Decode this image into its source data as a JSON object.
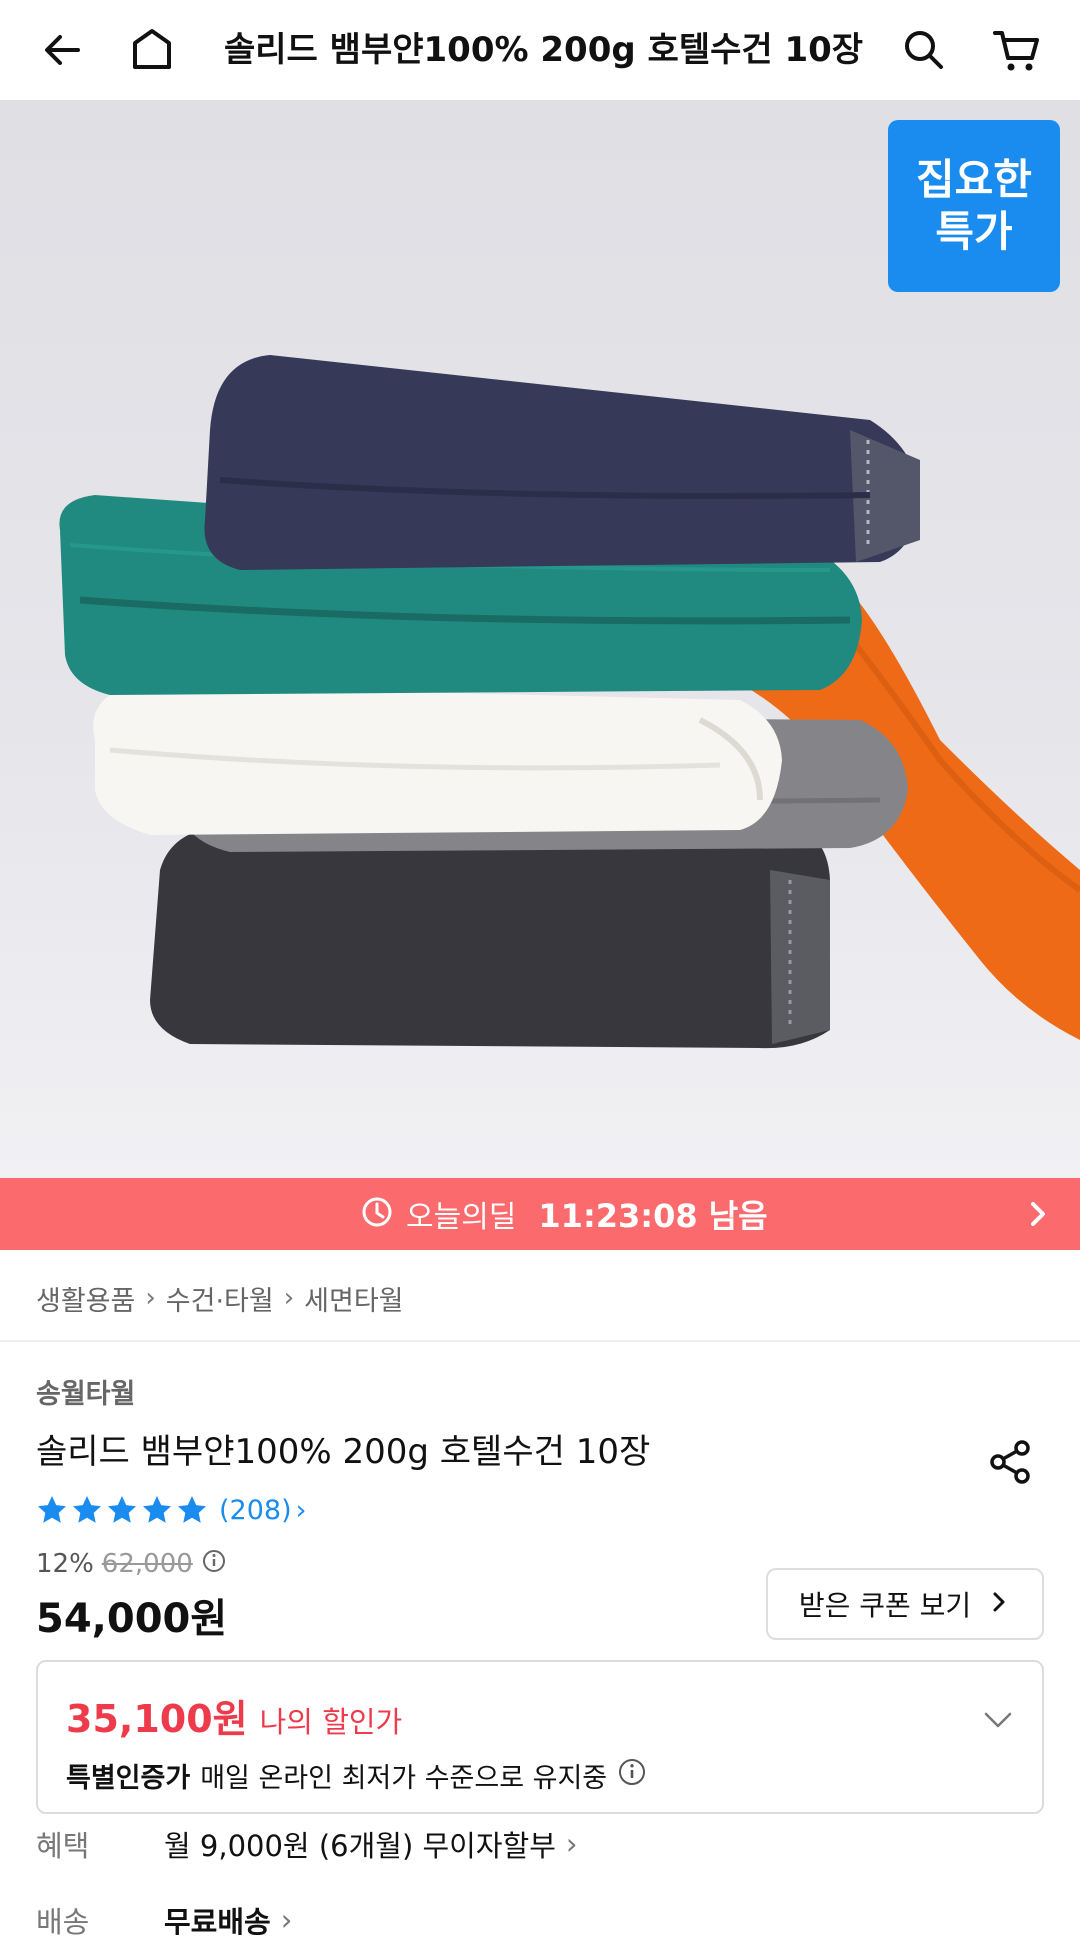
{
  "header": {
    "title": "솔리드 뱀부얀100% 200g 호텔수건 10장",
    "icons": [
      "back-arrow-icon",
      "home-icon",
      "search-icon",
      "cart-icon"
    ]
  },
  "badge": {
    "line1": "집요한",
    "line2": "특가"
  },
  "deal": {
    "label": "오늘의딜",
    "time": "11:23:08 남음"
  },
  "breadcrumb": [
    "생활용품",
    "수건·타월",
    "세면타월"
  ],
  "product": {
    "brand": "송월타월",
    "name": "솔리드 뱀부얀100% 200g 호텔수건 10장",
    "stars": 5,
    "review_count": "(208)",
    "discount_rate": "12%",
    "original_price": "62,000",
    "price": "54,000원"
  },
  "coupon": {
    "label": "받은 쿠폰 보기"
  },
  "my_discount": {
    "amount": "35,100원",
    "label": "나의 할인가",
    "cert_strong": "특별인증가",
    "cert_text": "매일 온라인 최저가 수준으로 유지중"
  },
  "benefit": {
    "label": "혜택",
    "value": "월 9,000원 (6개월) 무이자할부"
  },
  "shipping": {
    "label": "배송",
    "value": "무료배송"
  },
  "colors": {
    "accent_blue": "#1a8cf0",
    "deal_red": "#fb6a6d",
    "price_red": "#ee3b4c"
  }
}
